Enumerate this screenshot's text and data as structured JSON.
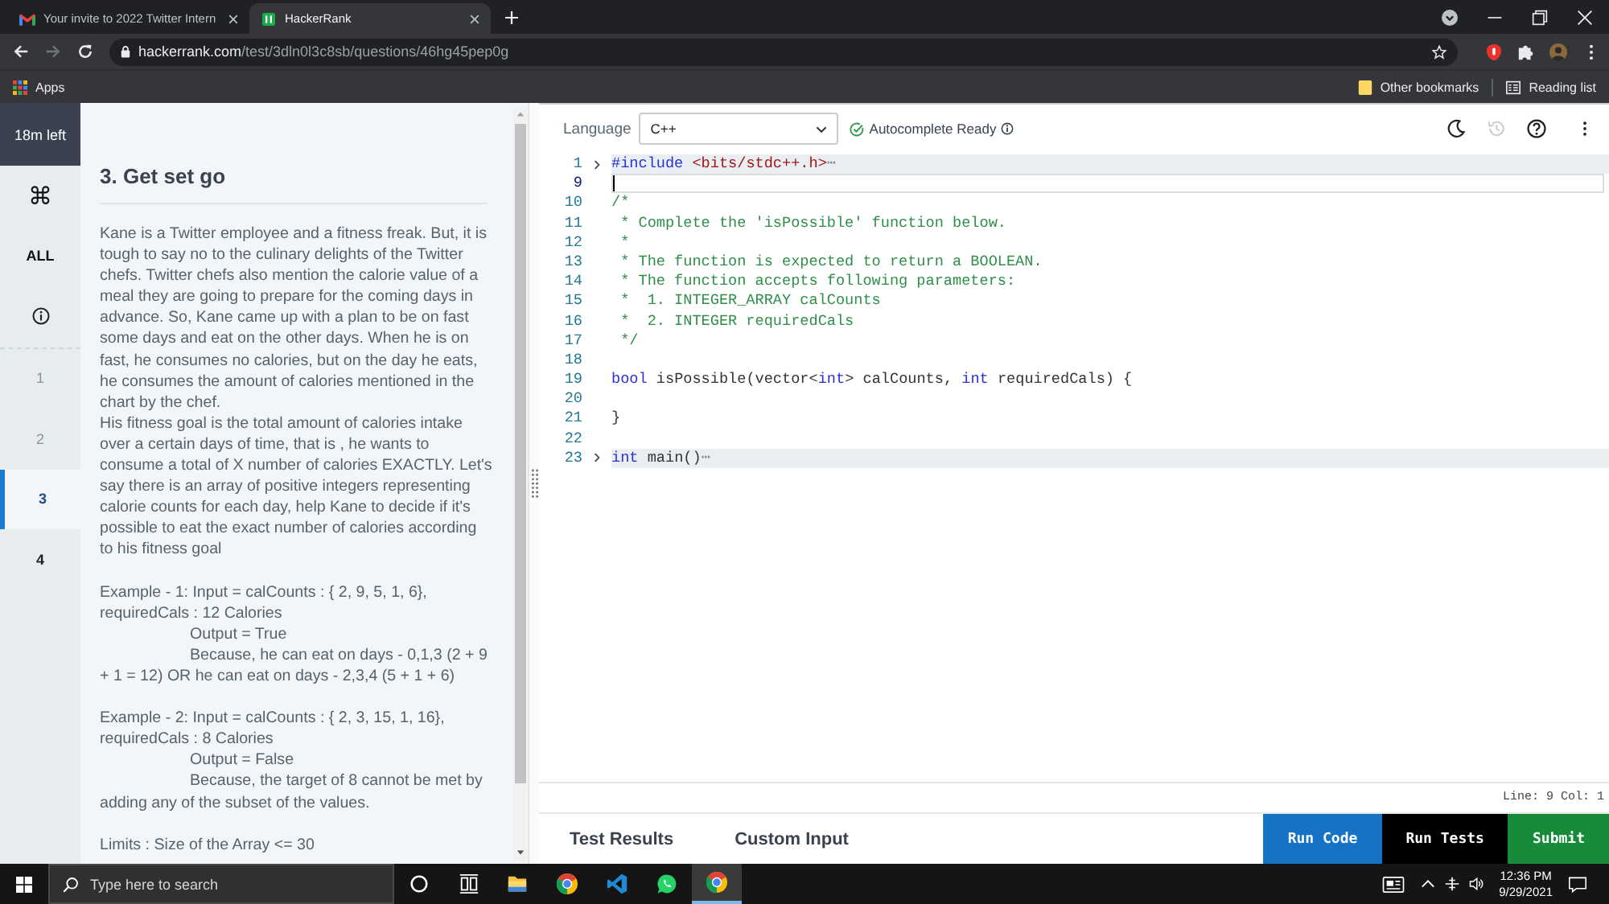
{
  "browser": {
    "tabs": [
      {
        "kind": "mail",
        "title": "Your invite to 2022 Twitter Intern",
        "selected": false
      },
      {
        "kind": "site",
        "title": "HackerRank",
        "selected": true
      }
    ],
    "url_host": "hackerrank.com",
    "url_path": "/test/3dln0l3c8sb/questions/46hg45pep0g",
    "bookmarks": [
      {
        "kind": "apps",
        "label": "Apps"
      }
    ],
    "bookmarks_right": [
      {
        "kind": "folder",
        "label": "Other bookmarks"
      },
      {
        "kind": "reading",
        "label": "Reading list"
      }
    ]
  },
  "sidebar": {
    "timer": "18m left",
    "tools": [
      {
        "label": "⌘"
      },
      {
        "label": "ALL"
      }
    ],
    "questions": [
      {
        "label": "1",
        "selected": false,
        "dimmed": true
      },
      {
        "label": "2",
        "selected": false,
        "dimmed": true
      },
      {
        "label": "3",
        "selected": true,
        "dimmed": false
      },
      {
        "label": "4",
        "selected": false,
        "dimmed": false
      }
    ]
  },
  "problem": {
    "title": "3. Get set go",
    "sections": [
      {
        "lines": [
          {
            "kind": "text",
            "text": "Kane is a Twitter employee and a fitness freak. But, it is tough to say no to the culinary delights of the Twitter chefs. Twitter chefs also mention the calorie value of a meal they are going to prepare for the coming days in advance. So, Kane came up with a plan to be on fast some days and eat on the other days. When he is on fast, he consumes no calories, but on the day he eats, he consumes the amount of calories mentioned in the chart by the chef."
          },
          {
            "kind": "text",
            "text": "His fitness goal is the total amount of calories intake over a certain days of time, that is , he wants to consume a total of X number of calories EXACTLY. Let's say there is an array of positive integers representing calorie counts for each day, help Kane to decide if it's possible to eat the exact number of calories according to his fitness goal"
          }
        ]
      },
      {
        "lines": [
          {
            "kind": "text",
            "text": "Example - 1: Input = calCounts : { 2, 9, 5, 1, 6}, requiredCals : 12 Calories"
          },
          {
            "kind": "indented",
            "text": "Output = True"
          },
          {
            "kind": "indented",
            "text": "Because, he can eat on days - 0,1,3 (2 + 9 + 1 = 12) OR he can eat on days - 2,3,4 (5 + 1 + 6)"
          }
        ]
      },
      {
        "lines": [
          {
            "kind": "text",
            "text": "Example - 2: Input = calCounts : { 2, 3, 15, 1, 16}, requiredCals : 8 Calories"
          },
          {
            "kind": "indented",
            "text": "Output = False"
          },
          {
            "kind": "indented",
            "text": "Because, the target of 8 cannot be met by adding any of the subset of the values."
          }
        ]
      },
      {
        "lines": [
          {
            "kind": "text",
            "text": "Limits : Size of the Array <= 30"
          }
        ]
      }
    ]
  },
  "editor": {
    "language_label": "Language",
    "language": "C++",
    "autocomplete": "Autocomplete Ready",
    "history_disabled": true,
    "lines": [
      {
        "number": "1",
        "folded": true,
        "current": false,
        "tokens": [
          {
            "kind": "keyword",
            "text": "#include"
          },
          {
            "kind": "string",
            "text": " <bits/stdc++.h>"
          }
        ],
        "fold_marker": "⋯"
      },
      {
        "number": "9",
        "folded": false,
        "current": true
      },
      {
        "number": "10",
        "folded": false,
        "current": false,
        "tokens": [
          {
            "kind": "comment",
            "text": "/*"
          }
        ]
      },
      {
        "number": "11",
        "folded": false,
        "current": false,
        "tokens": [
          {
            "kind": "comment",
            "text": " * Complete the 'isPossible' function below."
          }
        ]
      },
      {
        "number": "12",
        "folded": false,
        "current": false,
        "tokens": [
          {
            "kind": "comment",
            "text": " *"
          }
        ]
      },
      {
        "number": "13",
        "folded": false,
        "current": false,
        "tokens": [
          {
            "kind": "comment",
            "text": " * The function is expected to return a BOOLEAN."
          }
        ]
      },
      {
        "number": "14",
        "folded": false,
        "current": false,
        "tokens": [
          {
            "kind": "comment",
            "text": " * The function accepts following parameters:"
          }
        ]
      },
      {
        "number": "15",
        "folded": false,
        "current": false,
        "tokens": [
          {
            "kind": "comment",
            "text": " *  1. INTEGER_ARRAY calCounts"
          }
        ]
      },
      {
        "number": "16",
        "folded": false,
        "current": false,
        "tokens": [
          {
            "kind": "comment",
            "text": " *  2. INTEGER requiredCals"
          }
        ]
      },
      {
        "number": "17",
        "folded": false,
        "current": false,
        "tokens": [
          {
            "kind": "comment",
            "text": " */"
          }
        ]
      },
      {
        "number": "18",
        "folded": false,
        "current": false
      },
      {
        "number": "19",
        "folded": false,
        "current": false,
        "tokens": [
          {
            "kind": "keyword",
            "text": "bool"
          },
          {
            "kind": "plain",
            "text": " isPossible(vector<"
          },
          {
            "kind": "keyword",
            "text": "int"
          },
          {
            "kind": "plain",
            "text": "> calCounts, "
          },
          {
            "kind": "keyword",
            "text": "int"
          },
          {
            "kind": "plain",
            "text": " requiredCals) {"
          }
        ]
      },
      {
        "number": "20",
        "folded": false,
        "current": false
      },
      {
        "number": "21",
        "folded": false,
        "current": false,
        "tokens": [
          {
            "kind": "plain",
            "text": "}"
          }
        ]
      },
      {
        "number": "22",
        "folded": false,
        "current": false
      },
      {
        "number": "23",
        "folded": true,
        "current": false,
        "tokens": [
          {
            "kind": "keyword",
            "text": "int"
          },
          {
            "kind": "plain",
            "text": " main()"
          }
        ],
        "fold_marker": "⋯"
      }
    ],
    "cursor_position": "Line: 9 Col: 1"
  },
  "bottom_bar": {
    "tabs": [
      {
        "label": "Test Results"
      },
      {
        "label": "Custom Input"
      }
    ],
    "actions": [
      {
        "kind": "primary",
        "label": "Run Code"
      },
      {
        "kind": "dark",
        "label": "Run Tests"
      },
      {
        "kind": "success",
        "label": "Submit"
      }
    ]
  },
  "taskbar": {
    "search_placeholder": "Type here to search",
    "apps": [
      {
        "kind": "ring",
        "selected": false
      },
      {
        "kind": "taskview",
        "selected": false
      },
      {
        "kind": "folder",
        "selected": false
      },
      {
        "kind": "browser",
        "selected": false
      },
      {
        "kind": "editor",
        "selected": false
      },
      {
        "kind": "chat",
        "selected": false
      },
      {
        "kind": "browser",
        "selected": true
      }
    ],
    "time": "12:36 PM",
    "date": "9/29/2021"
  }
}
